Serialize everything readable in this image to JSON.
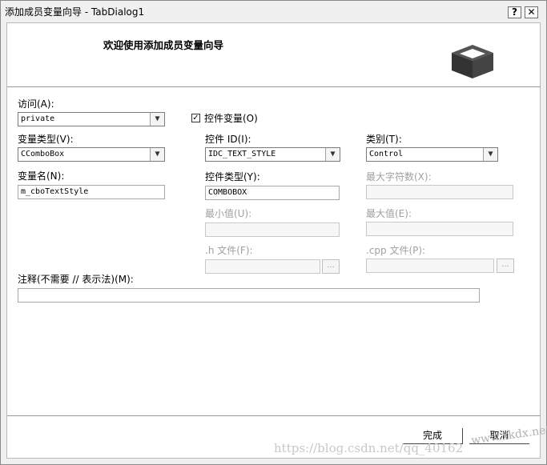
{
  "window": {
    "title": "添加成员变量向导 - TabDialog1",
    "help_button": "?",
    "close_button": "✕"
  },
  "header": {
    "title": "欢迎使用添加成员变量向导",
    "icon": "box-icon"
  },
  "form": {
    "access": {
      "label": "访问(A):",
      "value": "private"
    },
    "control_variable": {
      "label": "控件变量(O)",
      "checked": true,
      "check_glyph": "✓"
    },
    "var_type": {
      "label": "变量类型(V):",
      "value": "CComboBox"
    },
    "var_name": {
      "label": "变量名(N):",
      "value": "m_cboTextStyle"
    },
    "control_id": {
      "label": "控件 ID(I):",
      "value": "IDC_TEXT_STYLE"
    },
    "category": {
      "label": "类别(T):",
      "value": "Control"
    },
    "control_type": {
      "label": "控件类型(Y):",
      "value": "COMBOBOX"
    },
    "max_chars": {
      "label": "最大字符数(X):",
      "value": ""
    },
    "min_value": {
      "label": "最小值(U):",
      "value": ""
    },
    "max_value": {
      "label": "最大值(E):",
      "value": ""
    },
    "h_file": {
      "label": ".h 文件(F):",
      "value": "",
      "browse": "..."
    },
    "cpp_file": {
      "label": ".cpp 文件(P):",
      "value": "",
      "browse": "..."
    },
    "comment": {
      "label": "注释(不需要 // 表示法)(M):",
      "value": ""
    },
    "dropdown_arrow": "▼"
  },
  "footer": {
    "finish_button": "完成",
    "cancel_button": "取消"
  },
  "watermark": {
    "url": "https://blog.csdn.net/qq_40162",
    "logo_text": "www.xkdx.net"
  }
}
